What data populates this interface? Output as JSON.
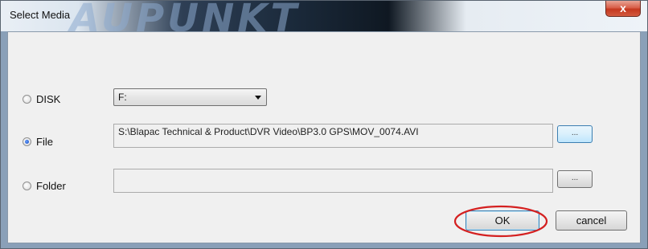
{
  "window": {
    "title": "Select Media",
    "watermark": "AUPUNKT",
    "close_label": "x"
  },
  "disk": {
    "label": "DISK",
    "selected": false,
    "drive_value": "F:"
  },
  "file": {
    "label": "File",
    "selected": true,
    "path_value": "S:\\Blapac Technical & Product\\DVR Video\\BP3.0 GPS\\MOV_0074.AVI",
    "browse_label": "..."
  },
  "folder": {
    "label": "Folder",
    "selected": false,
    "path_value": "",
    "browse_label": "..."
  },
  "buttons": {
    "ok_label": "OK",
    "cancel_label": "cancel"
  },
  "colors": {
    "annotation_circle": "#d42020",
    "focus_accent": "#3c7fb1"
  },
  "icons": {
    "close": "close-icon",
    "dropdown": "chevron-down-icon",
    "radio": "radio-icon"
  }
}
